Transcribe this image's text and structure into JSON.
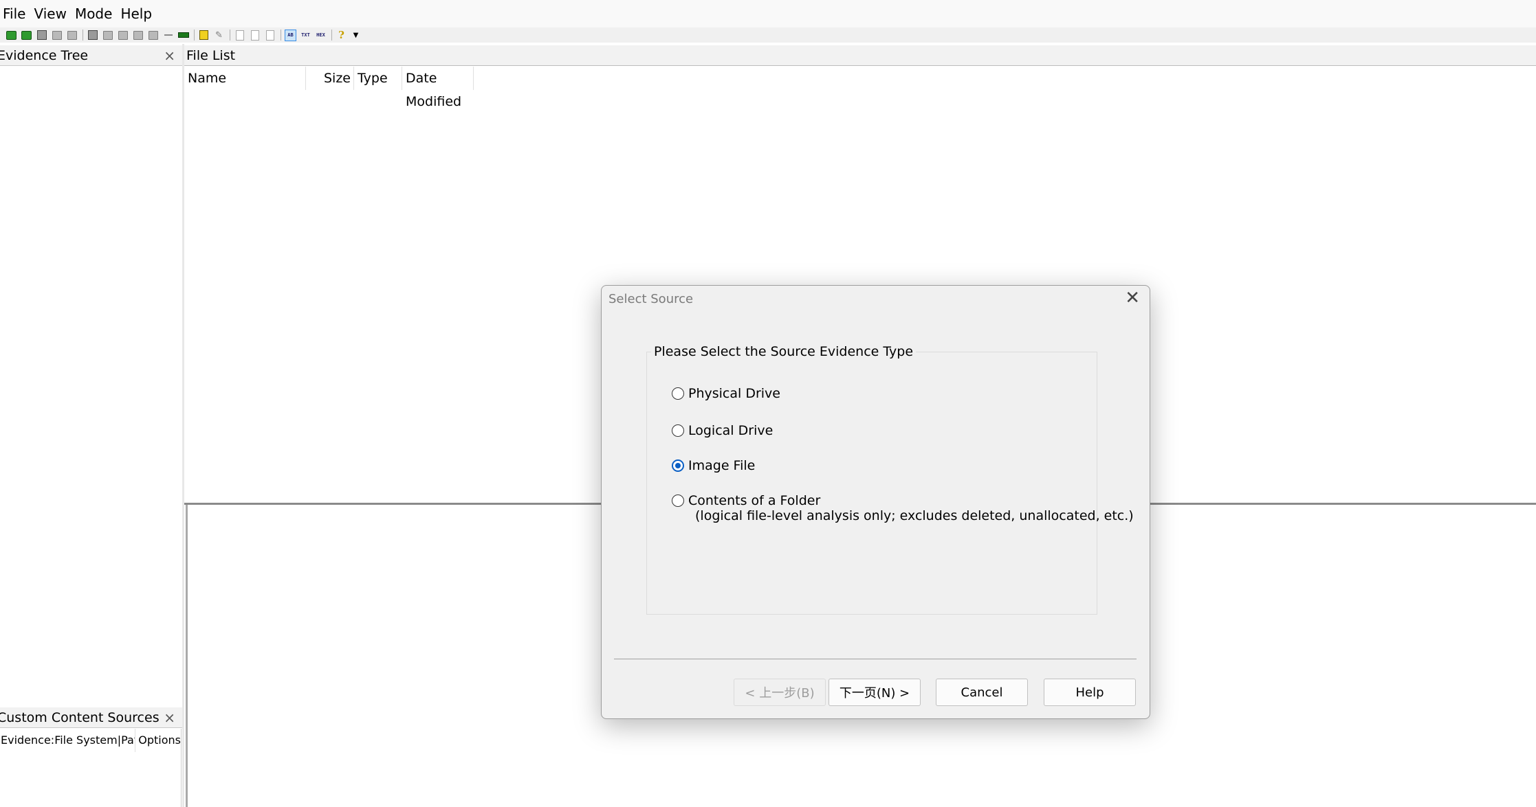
{
  "menu": [
    "File",
    "View",
    "Mode",
    "Help"
  ],
  "evidence_tree": {
    "title": "Evidence Tree",
    "close": "×"
  },
  "file_list": {
    "title": "File List",
    "columns": [
      "Name",
      "Size",
      "Type",
      "Date Modified"
    ]
  },
  "custom_content_sources": {
    "title": "Custom Content Sources",
    "close": "×",
    "columns": [
      "Evidence:File System|Path|...",
      "Options"
    ]
  },
  "dialog": {
    "title": "Select Source",
    "close": "✕",
    "group_title": "Please Select the Source Evidence Type",
    "options": [
      {
        "label": "Physical Drive",
        "checked": false
      },
      {
        "label": "Logical Drive",
        "checked": false
      },
      {
        "label": "Image File",
        "checked": true
      },
      {
        "label": "Contents of a Folder",
        "checked": false
      }
    ],
    "folder_note": "(logical file-level analysis only; excludes deleted, unallocated, etc.)",
    "buttons": {
      "back": "< 上一步(B)",
      "next": "下一页(N) >",
      "cancel": "Cancel",
      "help": "Help"
    },
    "back_enabled": false
  },
  "toolbar_icons": [
    "add-evidence-icon",
    "add-evidence-icon",
    "image-icon",
    "remove-evidence-icon",
    "remove-all-icon",
    "create-image-icon",
    "export-icon",
    "export-files-icon",
    "verify-icon",
    "verify-drive-icon",
    "capture-memory-icon",
    "obtain-files-icon",
    "detect-encryption-icon",
    "decrypt-icon",
    "new-doc-icon",
    "doc-icon",
    "doc-icon",
    "auto-view-icon",
    "text-view-icon",
    "hex-view-icon",
    "help-icon"
  ]
}
